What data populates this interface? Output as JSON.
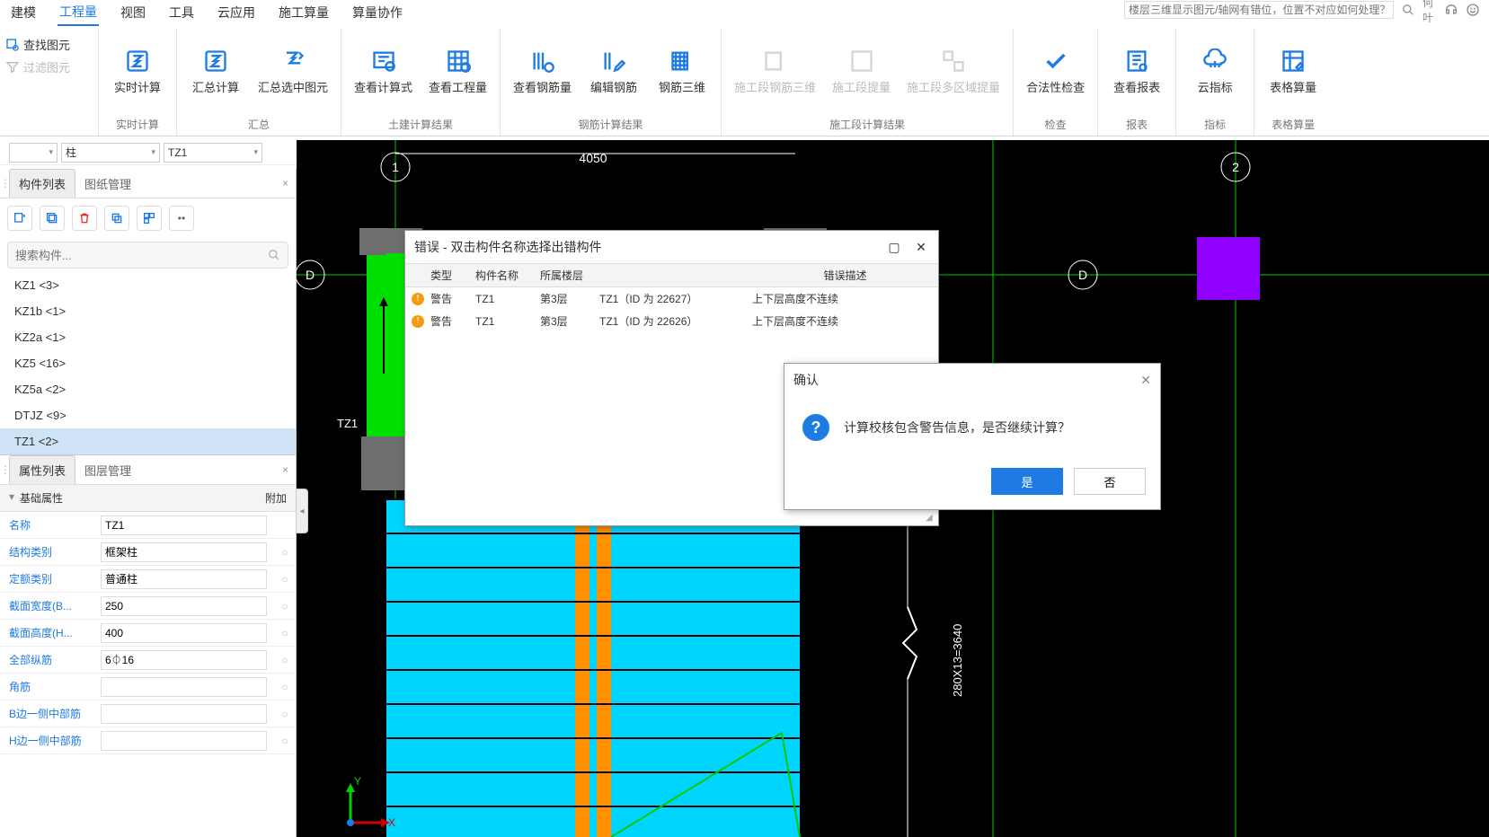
{
  "titlebar": {
    "search_placeholder": "楼层三维显示图元/轴网有错位，位置不对应如何处理？",
    "user": "何叶"
  },
  "menu": {
    "items": [
      "建模",
      "工程量",
      "视图",
      "工具",
      "云应用",
      "施工算量",
      "算量协作"
    ],
    "active_index": 1
  },
  "ribbon": {
    "side": {
      "find": "查找图元",
      "filter": "过滤图元"
    },
    "groups": [
      {
        "label": "实时计算",
        "items": [
          {
            "t": "实时计算",
            "i": "sigma"
          }
        ]
      },
      {
        "label": "汇总",
        "items": [
          {
            "t": "汇总计算",
            "i": "sigma-box"
          },
          {
            "t": "汇总选中图元",
            "i": "sigma-arrow"
          }
        ]
      },
      {
        "label": "土建计算结果",
        "items": [
          {
            "t": "查看计算式",
            "i": "calc"
          },
          {
            "t": "查看工程量",
            "i": "grid-mag"
          }
        ]
      },
      {
        "label": "钢筋计算结果",
        "items": [
          {
            "t": "查看钢筋量",
            "i": "rebar-mag"
          },
          {
            "t": "编辑钢筋",
            "i": "rebar-edit"
          },
          {
            "t": "钢筋三维",
            "i": "rebar-3d"
          }
        ]
      },
      {
        "label": "施工段计算结果",
        "items": [
          {
            "t": "施工段钢筋三维",
            "i": "d",
            "d": true
          },
          {
            "t": "施工段提量",
            "i": "d",
            "d": true
          },
          {
            "t": "施工段多区域提量",
            "i": "d",
            "d": true
          }
        ]
      },
      {
        "label": "检查",
        "items": [
          {
            "t": "合法性检查",
            "i": "check"
          }
        ]
      },
      {
        "label": "报表",
        "items": [
          {
            "t": "查看报表",
            "i": "report"
          }
        ]
      },
      {
        "label": "指标",
        "items": [
          {
            "t": "云指标",
            "i": "cloud"
          }
        ]
      },
      {
        "label": "表格算量",
        "items": [
          {
            "t": "表格算量",
            "i": "table-pen"
          }
        ]
      }
    ]
  },
  "filter": {
    "d1": "",
    "d2": "柱",
    "d3": "TZ1"
  },
  "left": {
    "tab1": "构件列表",
    "tab2": "图纸管理",
    "search_placeholder": "搜索构件...",
    "items": [
      {
        "t": "KZ1  <3>"
      },
      {
        "t": "KZ1b  <1>"
      },
      {
        "t": "KZ2a  <1>"
      },
      {
        "t": "KZ5  <16>"
      },
      {
        "t": "KZ5a  <2>"
      },
      {
        "t": "DTJZ  <9>"
      },
      {
        "t": "TZ1  <2>",
        "sel": true
      }
    ]
  },
  "props": {
    "tab1": "属性列表",
    "tab2": "图层管理",
    "section": "基础属性",
    "append": "附加",
    "rows": [
      {
        "l": "名称",
        "v": "TZ1",
        "dot": false
      },
      {
        "l": "结构类别",
        "v": "框架柱",
        "dot": true
      },
      {
        "l": "定额类别",
        "v": "普通柱",
        "dot": true
      },
      {
        "l": "截面宽度(B...",
        "v": "250",
        "dot": true
      },
      {
        "l": "截面高度(H...",
        "v": "400",
        "dot": true
      },
      {
        "l": "全部纵筋",
        "v": "6⏀16",
        "dot": true
      },
      {
        "l": "角筋",
        "v": "",
        "dot": true
      },
      {
        "l": "B边一侧中部筋",
        "v": "",
        "dot": true
      },
      {
        "l": "H边一侧中部筋",
        "v": "",
        "dot": true
      }
    ]
  },
  "canvas": {
    "dim1": "4050",
    "grid1": "1",
    "grid2": "2",
    "gridD1": "D",
    "gridD2": "D",
    "tz1": "TZ1",
    "dimv": "280X13=3640",
    "axisX": "X",
    "axisY": "Y"
  },
  "errdlg": {
    "title": "错误 - 双击构件名称选择出错构件",
    "h1": "类型",
    "h2": "构件名称",
    "h3": "所属楼层",
    "h4": "",
    "h5": "错误描述",
    "rows": [
      {
        "type": "警告",
        "name": "TZ1",
        "floor": "第3层",
        "id": "TZ1（ID 为 22627）",
        "desc": "上下层高度不连续"
      },
      {
        "type": "警告",
        "name": "TZ1",
        "floor": "第3层",
        "id": "TZ1（ID 为 22626）",
        "desc": "上下层高度不连续"
      }
    ]
  },
  "confirm": {
    "title": "确认",
    "msg": "计算校核包含警告信息，是否继续计算？",
    "yes": "是",
    "no": "否"
  }
}
